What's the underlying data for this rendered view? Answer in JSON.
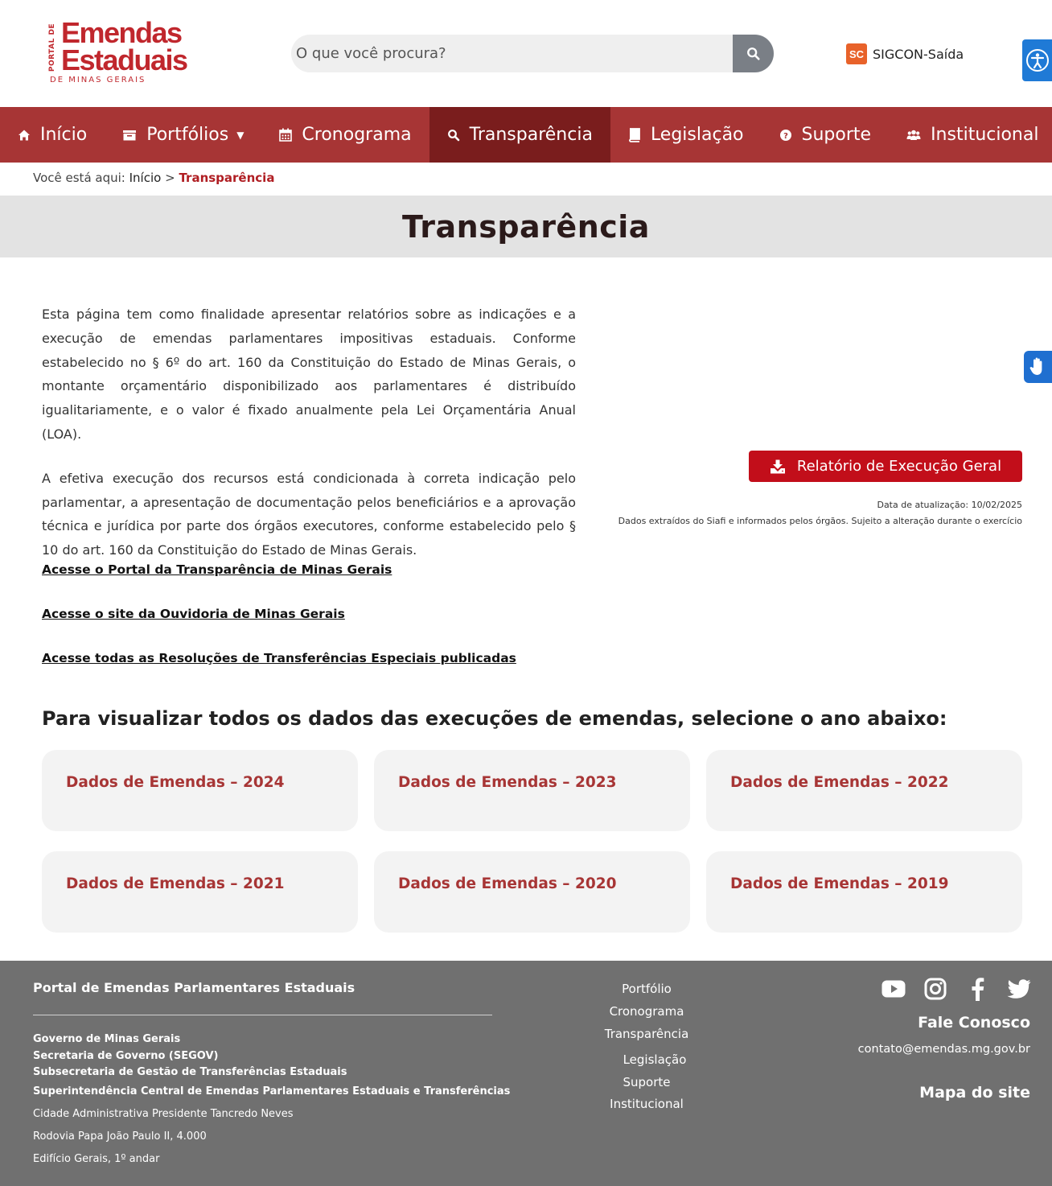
{
  "header": {
    "logo": {
      "side_text": "PORTAL DE",
      "line1": "Emendas",
      "line2": "Estaduais",
      "line3": "DE MINAS GERAIS"
    },
    "search": {
      "placeholder": "O que você procura?"
    },
    "sigcon": {
      "icon_text": "SC",
      "label": "SIGCON-Saída"
    }
  },
  "nav": {
    "items": [
      {
        "label": "Início",
        "icon": "home-icon"
      },
      {
        "label": "Portfólios",
        "icon": "folder-icon"
      },
      {
        "label": "Cronograma",
        "icon": "calendar-icon"
      },
      {
        "label": "Transparência",
        "icon": "search-icon",
        "active": true
      },
      {
        "label": "Legislação",
        "icon": "book-icon"
      },
      {
        "label": "Suporte",
        "icon": "help-icon"
      },
      {
        "label": "Institucional",
        "icon": "users-icon"
      }
    ]
  },
  "breadcrumb": {
    "prefix": "Você está aqui:",
    "home": "Início",
    "sep": ">",
    "current": "Transparência"
  },
  "page": {
    "title": "Transparência",
    "intro_p1": "Esta página tem como finalidade apresentar relatórios sobre as indicações e a execução de emendas parlamentares impositivas estaduais. Conforme estabelecido no § 6º do art. 160 da Constituição do Estado de Minas Gerais, o montante orçamentário disponibilizado aos parlamentares é distribuído igualitariamente, e o valor é fixado anualmente pela Lei Orçamentária Anual (LOA).",
    "intro_p2": "A efetiva execução dos recursos está condicionada à correta indicação pelo parlamentar, a apresentação de documentação pelos beneficiários e a aprovação técnica e jurídica por parte dos órgãos executores, conforme estabelecido pelo § 10 do art. 160 da Constituição do Estado de Minas Gerais.",
    "links": [
      "Acesse o Portal da Transparência de Minas Gerais",
      "Acesse o site da Ouvidoria de Minas Gerais",
      "Acesse todas as Resoluções de Transferências Especiais publicadas"
    ],
    "report_button": "Relatório de Execução Geral",
    "update_date": "Data de atualização: 10/02/2025",
    "source_note": "Dados extraídos do Siafi e informados pelos órgãos. Sujeito a alteração durante o exercício",
    "years_heading": "Para visualizar todos os dados das execuções de emendas, selecione o ano abaixo:",
    "year_cards": [
      "Dados de Emendas – 2024",
      "Dados de Emendas – 2023",
      "Dados de Emendas – 2022",
      "Dados de Emendas – 2021",
      "Dados de Emendas – 2020",
      "Dados de Emendas – 2019"
    ]
  },
  "footer": {
    "title": "Portal de Emendas Parlamentares Estaduais",
    "org_lines": [
      "Governo de Minas Gerais",
      "Secretaria de Governo (SEGOV)",
      "Subsecretaria de Gestão de Transferências Estaduais",
      "Superintendência Central de Emendas Parlamentares Estaduais e Transferências"
    ],
    "address_lines": [
      "Cidade Administrativa Presidente Tancredo Neves",
      "Rodovia Papa João Paulo II, 4.000",
      "Edifício Gerais, 1º andar"
    ],
    "nav": [
      "Portfólio",
      "Cronograma",
      "Transparência",
      "Legislação",
      "Suporte",
      "Institucional"
    ],
    "social": [
      "youtube-icon",
      "instagram-icon",
      "facebook-icon",
      "twitter-icon"
    ],
    "contact_title": "Fale Conosco",
    "email": "contato@emendas.mg.gov.br",
    "sitemap": "Mapa do site"
  },
  "colors": {
    "brand_red": "#a73535",
    "active_red": "#7a1d1d",
    "button_red": "#c20e1a",
    "footer_gray": "#707070",
    "a11y_blue": "#1f7ad6"
  }
}
